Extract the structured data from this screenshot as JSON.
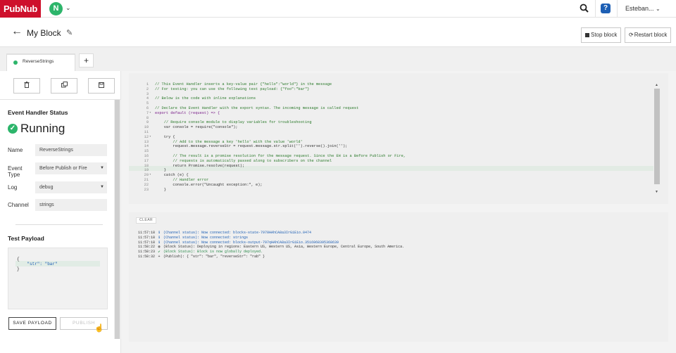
{
  "topbar": {
    "logo": "PubNub",
    "avatar_initial": "N",
    "user_name": "Esteban...",
    "help_label": "?"
  },
  "header": {
    "title": "My Block",
    "stop_label": "Stop block",
    "restart_label": "Restart block"
  },
  "tabs": [
    {
      "label": "ReverseStrings",
      "status_color": "#2db56b"
    }
  ],
  "left_panel": {
    "section_title": "Event Handler Status",
    "status": "Running",
    "fields": {
      "name_label": "Name",
      "name_value": "ReverseStrings",
      "event_type_label": "Event Type",
      "event_type_value": "Before Publish or Fire",
      "log_label": "Log",
      "log_value": "debug",
      "channel_label": "Channel",
      "channel_value": "strings"
    },
    "payload_title": "Test Payload",
    "payload_lines": [
      "{",
      "    \"str\": \"bar\"",
      "}"
    ],
    "save_label": "SAVE PAYLOAD",
    "publish_label": "PUBLISH"
  },
  "editor": {
    "lines": [
      {
        "n": "1",
        "fold": "",
        "t": "// This Event Handler inserts a key-value pair {\"hello\":\"world\"} in the message",
        "c": "cm"
      },
      {
        "n": "2",
        "fold": "",
        "t": "// For testing: you can use the following test payload: {\"foo\":\"bar\"}",
        "c": "cm"
      },
      {
        "n": "3",
        "fold": "",
        "t": "",
        "c": ""
      },
      {
        "n": "4",
        "fold": "",
        "t": "// Below is the code with inline explanations",
        "c": "cm"
      },
      {
        "n": "5",
        "fold": "",
        "t": "",
        "c": ""
      },
      {
        "n": "6",
        "fold": "",
        "t": "// Declare the Event Handler with the export syntax. The incoming message is called request",
        "c": "cm"
      },
      {
        "n": "7",
        "fold": "▾",
        "t": "export default (request) => {",
        "c": "kw"
      },
      {
        "n": "8",
        "fold": "",
        "t": "",
        "c": ""
      },
      {
        "n": "9",
        "fold": "",
        "t": "    // Require console module to display variables for troubleshooting",
        "c": "cm"
      },
      {
        "n": "10",
        "fold": "",
        "t": "    var console = require(\"console\");",
        "c": ""
      },
      {
        "n": "11",
        "fold": "",
        "t": "",
        "c": ""
      },
      {
        "n": "12",
        "fold": "▾",
        "t": "    try {",
        "c": ""
      },
      {
        "n": "13",
        "fold": "",
        "t": "        // Add to the message a key 'hello' with the value 'world'",
        "c": "cm"
      },
      {
        "n": "14",
        "fold": "",
        "t": "        request.message.reverseStr = request.message.str.split('').reverse().join('');",
        "c": ""
      },
      {
        "n": "15",
        "fold": "",
        "t": "",
        "c": ""
      },
      {
        "n": "16",
        "fold": "",
        "t": "        // The result is a promise resolution for the message request. Since the EH is a Before Publish or Fire,",
        "c": "cm"
      },
      {
        "n": "17",
        "fold": "",
        "t": "        // requests is automatically passed along to subscribers on the channel",
        "c": "cm"
      },
      {
        "n": "18",
        "fold": "",
        "t": "        return Promise.resolve(request);",
        "c": ""
      },
      {
        "n": "19",
        "fold": "",
        "t": "    }",
        "c": ""
      },
      {
        "n": "20",
        "fold": "▾",
        "t": "    catch (e) {",
        "c": ""
      },
      {
        "n": "21",
        "fold": "",
        "t": "        // Handler error",
        "c": "cm"
      },
      {
        "n": "22",
        "fold": "",
        "t": "        console.error(\"Uncaught exception:\", e);",
        "c": ""
      },
      {
        "n": "23",
        "fold": "",
        "t": "    }",
        "c": ""
      }
    ]
  },
  "console": {
    "clear_label": "CLEAR",
    "logs": [
      {
        "ts": "11:57:18",
        "icon": "ℹ",
        "kind": "info",
        "msg": "(Channel status): Now connected: blocks-state-7970HAhCA8a3IrG1Eio.0474"
      },
      {
        "ts": "11:57:18",
        "icon": "ℹ",
        "kind": "info",
        "msg": "(Channel status): Now connected: strings"
      },
      {
        "ts": "11:57:18",
        "icon": "ℹ",
        "kind": "info",
        "msg": "(Channel status): Now connected: blocks-output-797qHAhCA8a3IrG1Eio.3516968395368639"
      },
      {
        "ts": "11:58:22",
        "icon": "◍",
        "kind": "plain",
        "msg": "(Block Status): Deploying in regions: Eastern US, Western US, Asia, Western Europe, Central Europe, South America."
      },
      {
        "ts": "11:58:23",
        "icon": "✔",
        "kind": "ok",
        "msg": "(Block Status): Block is now globally deployed."
      },
      {
        "ts": "11:58:32",
        "icon": "+",
        "kind": "plain",
        "msg": "(Publish): { \"str\": \"bar\", \"reverseStr\": \"rab\" }"
      }
    ]
  },
  "colors": {
    "brand": "#ce102c",
    "running": "#2db56b",
    "help": "#1d5fb4"
  }
}
